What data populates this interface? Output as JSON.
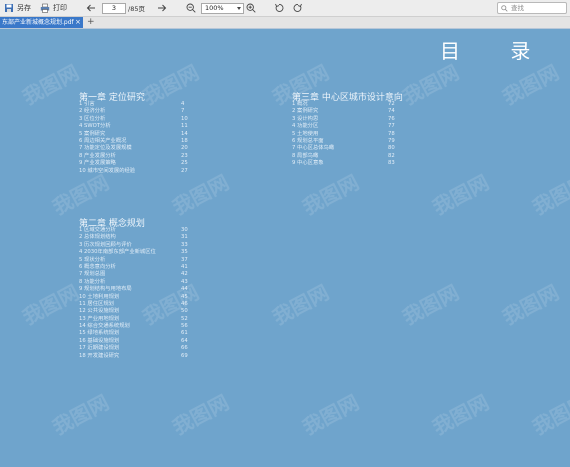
{
  "toolbar": {
    "save_as": "另存",
    "print": "打印",
    "page_current": "3",
    "page_total": "/85页",
    "zoom": "100%",
    "search_placeholder": "查找"
  },
  "tabs": [
    {
      "label": "东部产业新城概念规划.pdf"
    }
  ],
  "document": {
    "title": "目 录",
    "chapters": [
      {
        "title": "第一章 定位研究",
        "items": [
          {
            "name": "1 引言",
            "page": "4"
          },
          {
            "name": "2 经济分析",
            "page": "7"
          },
          {
            "name": "3 区位分析",
            "page": "10"
          },
          {
            "name": "4 SWOT分析",
            "page": "11"
          },
          {
            "name": "5 案例研究",
            "page": "14"
          },
          {
            "name": "6 周边相关产业概况",
            "page": "18"
          },
          {
            "name": "7 功能定位及发展规模",
            "page": "20"
          },
          {
            "name": "8 产业发展分析",
            "page": "23"
          },
          {
            "name": "9 产业发展策略",
            "page": "25"
          },
          {
            "name": "10 城市空间发展的经验",
            "page": "27"
          }
        ]
      },
      {
        "title": "第二章 概念规划",
        "items": [
          {
            "name": "1 区域交通分析",
            "page": "30"
          },
          {
            "name": "2 总体规划结构",
            "page": "31"
          },
          {
            "name": "3 历次规划回顾与评价",
            "page": "33"
          },
          {
            "name": "4 2030年南部东部产业新城区位",
            "page": "35"
          },
          {
            "name": "5 现状分析",
            "page": "37"
          },
          {
            "name": "6 概念意向分析",
            "page": "41"
          },
          {
            "name": "7 规划总图",
            "page": "42"
          },
          {
            "name": "8 功能分析",
            "page": "43"
          },
          {
            "name": "9 规划结构与用地布局",
            "page": "44"
          },
          {
            "name": "10 土地利用规划",
            "page": "45"
          },
          {
            "name": "11 居住区规划",
            "page": "46"
          },
          {
            "name": "12 公共设施规划",
            "page": "50"
          },
          {
            "name": "13 产业用地规划",
            "page": "52"
          },
          {
            "name": "14 综合交通系统规划",
            "page": "56"
          },
          {
            "name": "15 绿地系统规划",
            "page": "61"
          },
          {
            "name": "16 基础设施规划",
            "page": "64"
          },
          {
            "name": "17 近期建设规划",
            "page": "66"
          },
          {
            "name": "18 开发建设研究",
            "page": "69"
          }
        ]
      },
      {
        "title": "第三章 中心区城市设计意向",
        "items": [
          {
            "name": "1 概况",
            "page": "72"
          },
          {
            "name": "2 案例研究",
            "page": "74"
          },
          {
            "name": "3 设计构思",
            "page": "76"
          },
          {
            "name": "4 功能分区",
            "page": "77"
          },
          {
            "name": "5 土地使用",
            "page": "78"
          },
          {
            "name": "6 规划总平面",
            "page": "79"
          },
          {
            "name": "7 中心区总体鸟瞰",
            "page": "80"
          },
          {
            "name": "8 局部鸟瞰",
            "page": "82"
          },
          {
            "name": "9 中心区意象",
            "page": "83"
          }
        ]
      }
    ]
  },
  "watermark": "我图网"
}
